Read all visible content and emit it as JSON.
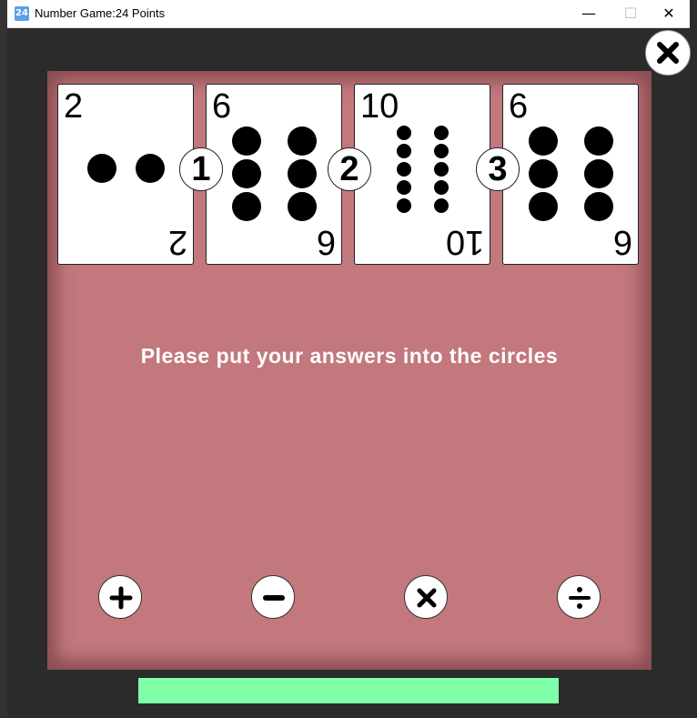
{
  "window": {
    "app_icon": "24",
    "title": "Number Game:24 Points",
    "minimize_icon": "minimize-icon",
    "maximize_icon": "maximize-icon",
    "close_icon": "close-icon"
  },
  "game": {
    "close_icon": "close-x-icon",
    "cards": [
      {
        "rank": "2",
        "pips": 2
      },
      {
        "rank": "6",
        "pips": 6
      },
      {
        "rank": "10",
        "pips": 10
      },
      {
        "rank": "6",
        "pips": 6
      }
    ],
    "slots": [
      "1",
      "2",
      "3"
    ],
    "instruction": "Please put your answers into the circles",
    "operators": [
      {
        "name": "plus",
        "icon": "plus-icon"
      },
      {
        "name": "minus",
        "icon": "minus-icon"
      },
      {
        "name": "times",
        "icon": "times-icon"
      },
      {
        "name": "divide",
        "icon": "divide-icon"
      }
    ],
    "colors": {
      "board": "#c2787c",
      "answer_bar": "#80ffa8",
      "card": "#ffffff",
      "background": "#2b2b2b"
    }
  }
}
